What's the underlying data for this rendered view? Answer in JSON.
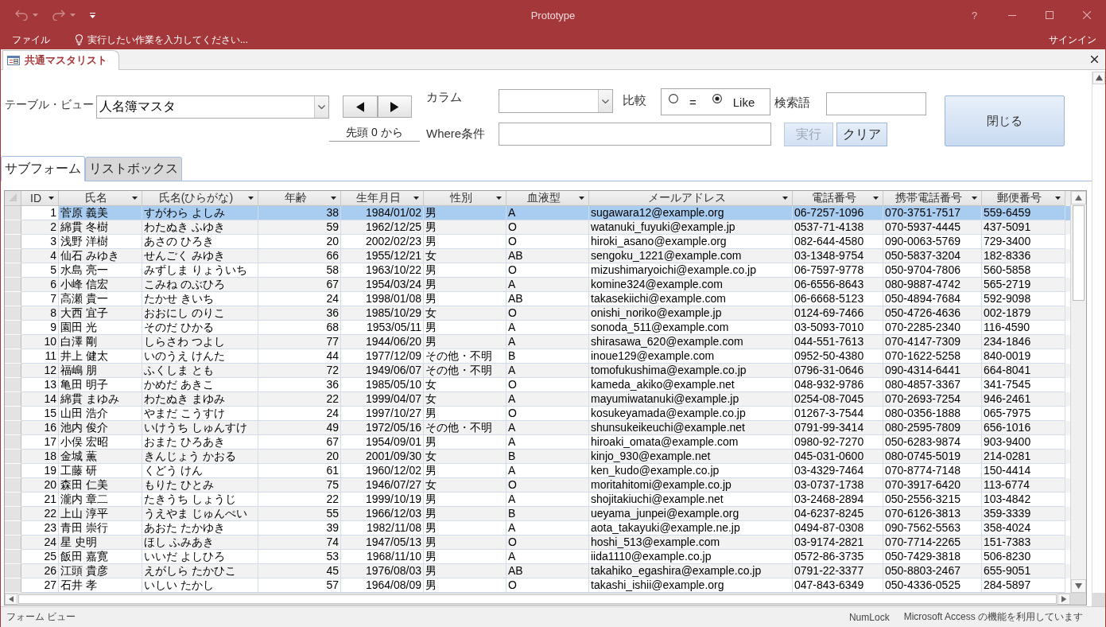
{
  "window": {
    "title": "Prototype",
    "help": "?"
  },
  "menu_bar": {
    "file_menu": "ファイル",
    "tell_me": "実行したい作業を入力してください...",
    "sign_in": "サインイン"
  },
  "document_tab": {
    "label": "共通マスタリスト"
  },
  "form": {
    "table_view": {
      "label": "テーブル・ビュー",
      "value": "人名簿マスタ"
    },
    "record_position": "先頭 0 から",
    "column": {
      "label": "カラム"
    },
    "compare": {
      "label": "比較",
      "options": [
        {
          "label": "=",
          "selected": false
        },
        {
          "label": "Like",
          "selected": true
        }
      ]
    },
    "search_term": {
      "label": "検索語"
    },
    "where": {
      "label": "Where条件"
    },
    "buttons": [
      {
        "label": "実行",
        "disabled": true
      },
      {
        "label": "クリア",
        "disabled": false
      }
    ],
    "close_button": {
      "label": "閉じる"
    }
  },
  "tabs": [
    {
      "label": "サブフォーム",
      "selected": true
    },
    {
      "label": "リストボックス",
      "selected": false
    }
  ],
  "table": {
    "columns": [
      {
        "label": "ID",
        "kind": "number"
      },
      {
        "label": "氏名",
        "kind": "text"
      },
      {
        "label": "氏名(ひらがな)",
        "kind": "text"
      },
      {
        "label": "年齢",
        "kind": "number"
      },
      {
        "label": "生年月日",
        "kind": "date"
      },
      {
        "label": "性別",
        "kind": "text"
      },
      {
        "label": "血液型",
        "kind": "text"
      },
      {
        "label": "メールアドレス",
        "kind": "text"
      },
      {
        "label": "電話番号",
        "kind": "text"
      },
      {
        "label": "携帯電話番号",
        "kind": "text"
      },
      {
        "label": "郵便番号",
        "kind": "text"
      }
    ],
    "rows": [
      {
        "selected": true,
        "cells": [
          "1",
          "菅原 義美",
          "すがわら よしみ",
          "38",
          "1984/01/02",
          "男",
          "A",
          "sugawara12@example.org",
          "06-7257-1096",
          "070-3751-7517",
          "559-6459"
        ]
      },
      {
        "selected": false,
        "cells": [
          "2",
          "綿貫 冬樹",
          "わたぬき ふゆき",
          "59",
          "1962/12/25",
          "男",
          "O",
          "watanuki_fuyuki@example.jp",
          "0537-71-4138",
          "070-5937-4445",
          "437-5091"
        ]
      },
      {
        "selected": false,
        "cells": [
          "3",
          "浅野 洋樹",
          "あさの ひろき",
          "20",
          "2002/02/23",
          "男",
          "O",
          "hiroki_asano@example.org",
          "082-644-4580",
          "090-0063-5769",
          "729-3400"
        ]
      },
      {
        "selected": false,
        "cells": [
          "4",
          "仙石 みゆき",
          "せんごく みゆき",
          "66",
          "1955/12/21",
          "女",
          "AB",
          "sengoku_1221@example.com",
          "03-1348-9754",
          "050-5837-3204",
          "182-8336"
        ]
      },
      {
        "selected": false,
        "cells": [
          "5",
          "水島 亮一",
          "みずしま りょういち",
          "58",
          "1963/10/22",
          "男",
          "O",
          "mizushimaryoichi@example.co.jp",
          "06-7597-9778",
          "050-9704-7806",
          "560-5858"
        ]
      },
      {
        "selected": false,
        "cells": [
          "6",
          "小峰 信宏",
          "こみね のぶひろ",
          "67",
          "1954/03/24",
          "男",
          "A",
          "komine324@example.com",
          "06-6556-8643",
          "080-9887-4742",
          "565-2719"
        ]
      },
      {
        "selected": false,
        "cells": [
          "7",
          "高瀬 貴一",
          "たかせ きいち",
          "24",
          "1998/01/08",
          "男",
          "AB",
          "takasekiichi@example.com",
          "06-6668-5123",
          "050-4894-7684",
          "592-9098"
        ]
      },
      {
        "selected": false,
        "cells": [
          "8",
          "大西 宜子",
          "おおにし のりこ",
          "36",
          "1985/10/29",
          "女",
          "O",
          "onishi_noriko@example.jp",
          "0124-69-7466",
          "050-4726-4636",
          "002-1879"
        ]
      },
      {
        "selected": false,
        "cells": [
          "9",
          "園田 光",
          "そのだ ひかる",
          "68",
          "1953/05/11",
          "男",
          "A",
          "sonoda_511@example.com",
          "03-5093-7010",
          "070-2285-2340",
          "116-4590"
        ]
      },
      {
        "selected": false,
        "cells": [
          "10",
          "白澤 剛",
          "しらさわ つよし",
          "77",
          "1944/06/20",
          "男",
          "A",
          "shirasawa_620@example.com",
          "044-551-7613",
          "070-4147-7309",
          "234-1846"
        ]
      },
      {
        "selected": false,
        "cells": [
          "11",
          "井上 健太",
          "いのうえ けんた",
          "44",
          "1977/12/09",
          "その他・不明",
          "B",
          "inoue129@example.com",
          "0952-50-4380",
          "070-1622-5258",
          "840-0019"
        ]
      },
      {
        "selected": false,
        "cells": [
          "12",
          "福嶋 朋",
          "ふくしま とも",
          "72",
          "1949/06/07",
          "その他・不明",
          "A",
          "tomofukushima@example.co.jp",
          "0796-31-0646",
          "090-4314-6441",
          "664-8041"
        ]
      },
      {
        "selected": false,
        "cells": [
          "13",
          "亀田 明子",
          "かめだ あきこ",
          "36",
          "1985/05/10",
          "女",
          "O",
          "kameda_akiko@example.net",
          "048-932-9786",
          "080-4857-3367",
          "341-7545"
        ]
      },
      {
        "selected": false,
        "cells": [
          "14",
          "綿貫 まゆみ",
          "わたぬき まゆみ",
          "22",
          "1999/04/07",
          "女",
          "A",
          "mayumiwatanuki@example.jp",
          "0254-08-7045",
          "070-2693-7254",
          "946-2461"
        ]
      },
      {
        "selected": false,
        "cells": [
          "15",
          "山田 浩介",
          "やまだ こうすけ",
          "24",
          "1997/10/27",
          "男",
          "O",
          "kosukeyamada@example.co.jp",
          "01267-3-7544",
          "080-0356-1888",
          "065-7975"
        ]
      },
      {
        "selected": false,
        "cells": [
          "16",
          "池内 俊介",
          "いけうち しゅんすけ",
          "49",
          "1972/05/16",
          "その他・不明",
          "A",
          "shunsukeikeuchi@example.net",
          "0791-99-3414",
          "080-2595-7809",
          "656-1016"
        ]
      },
      {
        "selected": false,
        "cells": [
          "17",
          "小俣 宏昭",
          "おまた ひろあき",
          "67",
          "1954/09/01",
          "男",
          "A",
          "hiroaki_omata@example.com",
          "0980-92-7270",
          "050-6283-9874",
          "903-9400"
        ]
      },
      {
        "selected": false,
        "cells": [
          "18",
          "金城 薫",
          "きんじょう かおる",
          "20",
          "2001/09/30",
          "女",
          "B",
          "kinjo_930@example.net",
          "045-031-0600",
          "080-0745-5019",
          "214-0281"
        ]
      },
      {
        "selected": false,
        "cells": [
          "19",
          "工藤 研",
          "くどう けん",
          "61",
          "1960/12/02",
          "男",
          "A",
          "ken_kudo@example.co.jp",
          "03-4329-7464",
          "070-8774-7148",
          "150-4414"
        ]
      },
      {
        "selected": false,
        "cells": [
          "20",
          "森田 仁美",
          "もりた ひとみ",
          "75",
          "1946/07/27",
          "女",
          "O",
          "moritahitomi@example.co.jp",
          "03-0737-1738",
          "070-3917-6420",
          "113-6774"
        ]
      },
      {
        "selected": false,
        "cells": [
          "21",
          "瀧内 章二",
          "たきうち しょうじ",
          "22",
          "1999/10/19",
          "男",
          "A",
          "shojitakiuchi@example.net",
          "03-2468-2894",
          "050-2556-3215",
          "103-4842"
        ]
      },
      {
        "selected": false,
        "cells": [
          "22",
          "上山 淳平",
          "うえやま じゅんぺい",
          "55",
          "1966/12/03",
          "男",
          "B",
          "ueyama_junpei@example.org",
          "04-6237-8245",
          "070-6126-3813",
          "359-3339"
        ]
      },
      {
        "selected": false,
        "cells": [
          "23",
          "青田 崇行",
          "あおた たかゆき",
          "39",
          "1982/11/08",
          "男",
          "A",
          "aota_takayuki@example.ne.jp",
          "0494-87-0308",
          "090-7562-5563",
          "358-4024"
        ]
      },
      {
        "selected": false,
        "cells": [
          "24",
          "星 史明",
          "ほし ふみあき",
          "74",
          "1947/05/13",
          "男",
          "O",
          "hoshi_513@example.com",
          "03-9174-2821",
          "070-7714-2265",
          "151-7383"
        ]
      },
      {
        "selected": false,
        "cells": [
          "25",
          "飯田 嘉寛",
          "いいだ よしひろ",
          "53",
          "1968/11/10",
          "男",
          "A",
          "iida1110@example.co.jp",
          "0572-86-3735",
          "050-7429-3818",
          "506-8230"
        ]
      },
      {
        "selected": false,
        "cells": [
          "26",
          "江頭 貴彦",
          "えがしら たかひこ",
          "45",
          "1976/08/03",
          "男",
          "AB",
          "takahiko_egashira@example.co.jp",
          "0791-22-3377",
          "050-8803-2467",
          "655-9051"
        ]
      },
      {
        "selected": false,
        "cells": [
          "27",
          "石井 孝",
          "いしい たかし",
          "57",
          "1964/08/09",
          "男",
          "O",
          "takashi_ishii@example.org",
          "047-843-6349",
          "050-4336-0525",
          "284-5897"
        ]
      }
    ]
  },
  "status_bar": {
    "view": "フォーム ビュー",
    "indicator": "NumLock",
    "message": "Microsoft Access の機能を利用しています"
  }
}
